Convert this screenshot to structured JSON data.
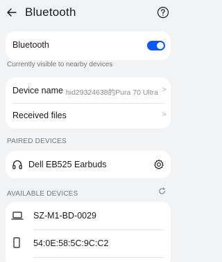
{
  "header": {
    "title": "Bluetooth",
    "back_icon": "arrow-left-icon",
    "help_icon": "question-circle-icon"
  },
  "bluetooth": {
    "label": "Bluetooth",
    "enabled": true,
    "toggle_color": "#0a59f7",
    "caption": "Currently visible to nearby devices"
  },
  "device_settings": {
    "device_name_label": "Device name",
    "device_name_value": "hid29324638的Pura 70 Ultra",
    "received_files_label": "Received files"
  },
  "paired": {
    "header": "PAIRED DEVICES",
    "devices": [
      {
        "name": "Dell EB525 Earbuds",
        "icon": "headphones-icon",
        "action_icon": "gear-icon"
      }
    ]
  },
  "available": {
    "header": "AVAILABLE DEVICES",
    "refresh_icon": "refresh-icon",
    "devices": [
      {
        "name": "SZ-M1-BD-0029",
        "icon": "laptop-icon"
      },
      {
        "name": "54:0E:58:5C:9C:C2",
        "icon": "phone-icon"
      }
    ]
  }
}
